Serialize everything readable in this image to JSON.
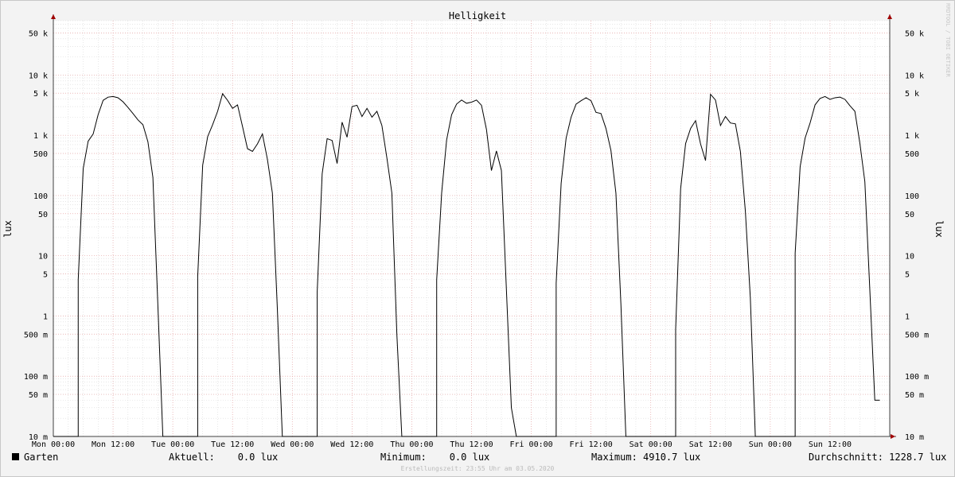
{
  "chart_data": {
    "type": "line",
    "title": "Helligkeit",
    "ylabel": "lux",
    "yscale": "log",
    "ylim": [
      0.01,
      80000
    ],
    "xlim": [
      0,
      168
    ],
    "yticks": [
      {
        "v": 50000,
        "label": "50 k"
      },
      {
        "v": 10000,
        "label": "10 k"
      },
      {
        "v": 5000,
        "label": "5 k"
      },
      {
        "v": 1000,
        "label": "1 k"
      },
      {
        "v": 500,
        "label": "500"
      },
      {
        "v": 100,
        "label": "100"
      },
      {
        "v": 50,
        "label": "50"
      },
      {
        "v": 10,
        "label": "10"
      },
      {
        "v": 5,
        "label": "5"
      },
      {
        "v": 1,
        "label": "1"
      },
      {
        "v": 0.5,
        "label": "500 m"
      },
      {
        "v": 0.1,
        "label": "100 m"
      },
      {
        "v": 0.05,
        "label": "50 m"
      },
      {
        "v": 0.01,
        "label": "10 m"
      }
    ],
    "xticks": [
      {
        "h": 0,
        "label": "Mon 00:00"
      },
      {
        "h": 12,
        "label": "Mon 12:00"
      },
      {
        "h": 24,
        "label": "Tue 00:00"
      },
      {
        "h": 36,
        "label": "Tue 12:00"
      },
      {
        "h": 48,
        "label": "Wed 00:00"
      },
      {
        "h": 60,
        "label": "Wed 12:00"
      },
      {
        "h": 72,
        "label": "Thu 00:00"
      },
      {
        "h": 84,
        "label": "Thu 12:00"
      },
      {
        "h": 96,
        "label": "Fri 00:00"
      },
      {
        "h": 108,
        "label": "Fri 12:00"
      },
      {
        "h": 120,
        "label": "Sat 00:00"
      },
      {
        "h": 132,
        "label": "Sat 12:00"
      },
      {
        "h": 144,
        "label": "Sun 00:00"
      },
      {
        "h": 156,
        "label": "Sun 12:00"
      }
    ],
    "series": [
      {
        "name": "Garten",
        "color": "#000000",
        "points": [
          [
            0,
            0.01
          ],
          [
            5,
            0.01
          ],
          [
            5,
            4
          ],
          [
            6,
            280
          ],
          [
            7,
            800
          ],
          [
            8,
            1050
          ],
          [
            9,
            2200
          ],
          [
            10,
            3800
          ],
          [
            11,
            4300
          ],
          [
            12,
            4400
          ],
          [
            13,
            4200
          ],
          [
            14,
            3600
          ],
          [
            15,
            2900
          ],
          [
            16,
            2300
          ],
          [
            17,
            1800
          ],
          [
            18,
            1500
          ],
          [
            19,
            780
          ],
          [
            20,
            200
          ],
          [
            21,
            1.5
          ],
          [
            22,
            0.01
          ],
          [
            29,
            0.01
          ],
          [
            29,
            4.5
          ],
          [
            30,
            320
          ],
          [
            31,
            950
          ],
          [
            32,
            1500
          ],
          [
            33,
            2500
          ],
          [
            34,
            4900
          ],
          [
            35,
            3800
          ],
          [
            36,
            2800
          ],
          [
            37,
            3200
          ],
          [
            38,
            1400
          ],
          [
            39,
            600
          ],
          [
            40,
            540
          ],
          [
            41,
            720
          ],
          [
            42,
            1050
          ],
          [
            43,
            400
          ],
          [
            44,
            110
          ],
          [
            45,
            1.3
          ],
          [
            46,
            0.01
          ],
          [
            53,
            0.01
          ],
          [
            53,
            2.5
          ],
          [
            54,
            230
          ],
          [
            55,
            880
          ],
          [
            56,
            820
          ],
          [
            57,
            340
          ],
          [
            58,
            1650
          ],
          [
            59,
            930
          ],
          [
            60,
            3000
          ],
          [
            61,
            3150
          ],
          [
            62,
            2050
          ],
          [
            63,
            2800
          ],
          [
            64,
            2000
          ],
          [
            65,
            2500
          ],
          [
            66,
            1450
          ],
          [
            67,
            420
          ],
          [
            68,
            110
          ],
          [
            69,
            0.5
          ],
          [
            70,
            0.01
          ],
          [
            77,
            0.01
          ],
          [
            77,
            4
          ],
          [
            78,
            110
          ],
          [
            79,
            840
          ],
          [
            80,
            2200
          ],
          [
            81,
            3300
          ],
          [
            82,
            3850
          ],
          [
            83,
            3400
          ],
          [
            84,
            3550
          ],
          [
            85,
            3850
          ],
          [
            86,
            3150
          ],
          [
            87,
            1250
          ],
          [
            88,
            260
          ],
          [
            89,
            550
          ],
          [
            90,
            260
          ],
          [
            91,
            2.8
          ],
          [
            92,
            0.03
          ],
          [
            93,
            0.01
          ],
          [
            101,
            0.01
          ],
          [
            101,
            3.5
          ],
          [
            102,
            160
          ],
          [
            103,
            900
          ],
          [
            104,
            2000
          ],
          [
            105,
            3300
          ],
          [
            106,
            3750
          ],
          [
            107,
            4200
          ],
          [
            108,
            3750
          ],
          [
            109,
            2400
          ],
          [
            110,
            2300
          ],
          [
            111,
            1300
          ],
          [
            112,
            560
          ],
          [
            113,
            110
          ],
          [
            114,
            1.6
          ],
          [
            115,
            0.01
          ],
          [
            125,
            0.01
          ],
          [
            125,
            0.6
          ],
          [
            126,
            130
          ],
          [
            127,
            730
          ],
          [
            128,
            1300
          ],
          [
            129,
            1750
          ],
          [
            130,
            720
          ],
          [
            131,
            380
          ],
          [
            132,
            4800
          ],
          [
            133,
            3850
          ],
          [
            134,
            1450
          ],
          [
            135,
            2050
          ],
          [
            136,
            1600
          ],
          [
            137,
            1550
          ],
          [
            138,
            540
          ],
          [
            139,
            55
          ],
          [
            140,
            2
          ],
          [
            141,
            0.01
          ],
          [
            149,
            0.01
          ],
          [
            149,
            11
          ],
          [
            150,
            300
          ],
          [
            151,
            900
          ],
          [
            152,
            1600
          ],
          [
            153,
            3200
          ],
          [
            154,
            4100
          ],
          [
            155,
            4400
          ],
          [
            156,
            3950
          ],
          [
            157,
            4200
          ],
          [
            158,
            4300
          ],
          [
            159,
            3950
          ],
          [
            160,
            3100
          ],
          [
            161,
            2500
          ],
          [
            162,
            740
          ],
          [
            163,
            170
          ],
          [
            164,
            2.7
          ],
          [
            165,
            0.04
          ],
          [
            166,
            0.04
          ]
        ]
      }
    ]
  },
  "right_ticks": [
    "50 k",
    "10 k",
    "5 k",
    "1 k",
    "500",
    "100",
    "50",
    "10",
    "5",
    "1",
    "500 m",
    "100 m",
    "50 m",
    "10 m"
  ],
  "legend": {
    "name": "Garten",
    "aktuell": "Aktuell:    0.0 lux",
    "minimum": "Minimum:    0.0 lux",
    "maximum": "Maximum: 4910.7 lux",
    "durchschnitt": "Durchschnitt: 1228.7 lux"
  },
  "footer": "Erstellungszeit: 23:55 Uhr am 03.05.2020",
  "watermark": "RRDTOOL / TOBI OETIKER"
}
